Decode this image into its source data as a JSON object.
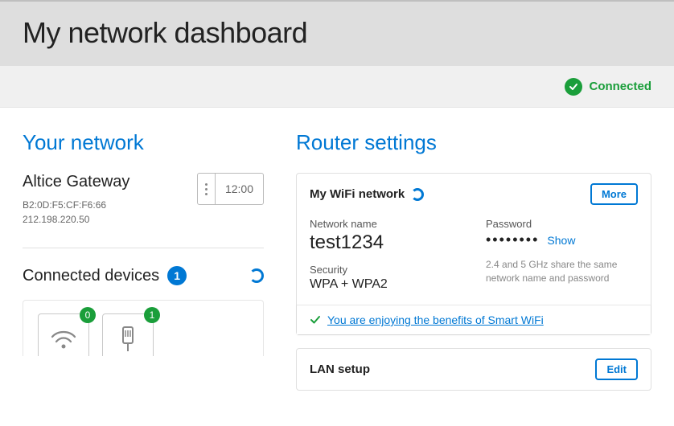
{
  "header": {
    "title": "My network dashboard"
  },
  "status": {
    "label": "Connected"
  },
  "left": {
    "section_title": "Your network",
    "gateway_name": "Altice Gateway",
    "mac": "B2:0D:F5:CF:F6:66",
    "ip": "212.198.220.50",
    "clock": "12:00",
    "connected_devices_title": "Connected devices",
    "connected_devices_count": "1",
    "devices": [
      {
        "type": "wifi",
        "badge": "0"
      },
      {
        "type": "ethernet",
        "badge": "1"
      }
    ]
  },
  "right": {
    "section_title": "Router settings",
    "wifi": {
      "card_title": "My WiFi network",
      "more_label": "More",
      "network_name_label": "Network name",
      "network_name": "test1234",
      "password_label": "Password",
      "password_masked": "••••••••",
      "show_label": "Show",
      "security_label": "Security",
      "security_value": "WPA + WPA2",
      "band_note": "2.4 and 5 GHz share the same network name and password",
      "smart_wifi_msg": "You are enjoying the benefits of Smart WiFi"
    },
    "lan": {
      "card_title": "LAN setup",
      "edit_label": "Edit"
    }
  }
}
